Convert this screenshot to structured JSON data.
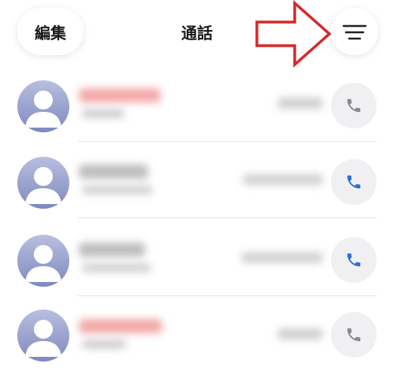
{
  "header": {
    "edit_label": "編集",
    "title": "通話",
    "filter_icon": "filter-icon"
  },
  "annotation": {
    "arrow_color": "#d62828",
    "points_to": "filter-button"
  },
  "calls": [
    {
      "name_color": "#f2a0a0",
      "phone_icon_color": "#8a8a8a",
      "missed": true
    },
    {
      "name_color": "#b9b9b9",
      "phone_icon_color": "#2f6fd6",
      "missed": false
    },
    {
      "name_color": "#b9b9b9",
      "phone_icon_color": "#2f6fd6",
      "missed": false
    },
    {
      "name_color": "#f2a0a0",
      "phone_icon_color": "#8a8a8a",
      "missed": true
    }
  ],
  "colors": {
    "avatar_bg": "#9aa4cf",
    "avatar_fg": "#ffffff",
    "divider": "#e6e6e6"
  }
}
